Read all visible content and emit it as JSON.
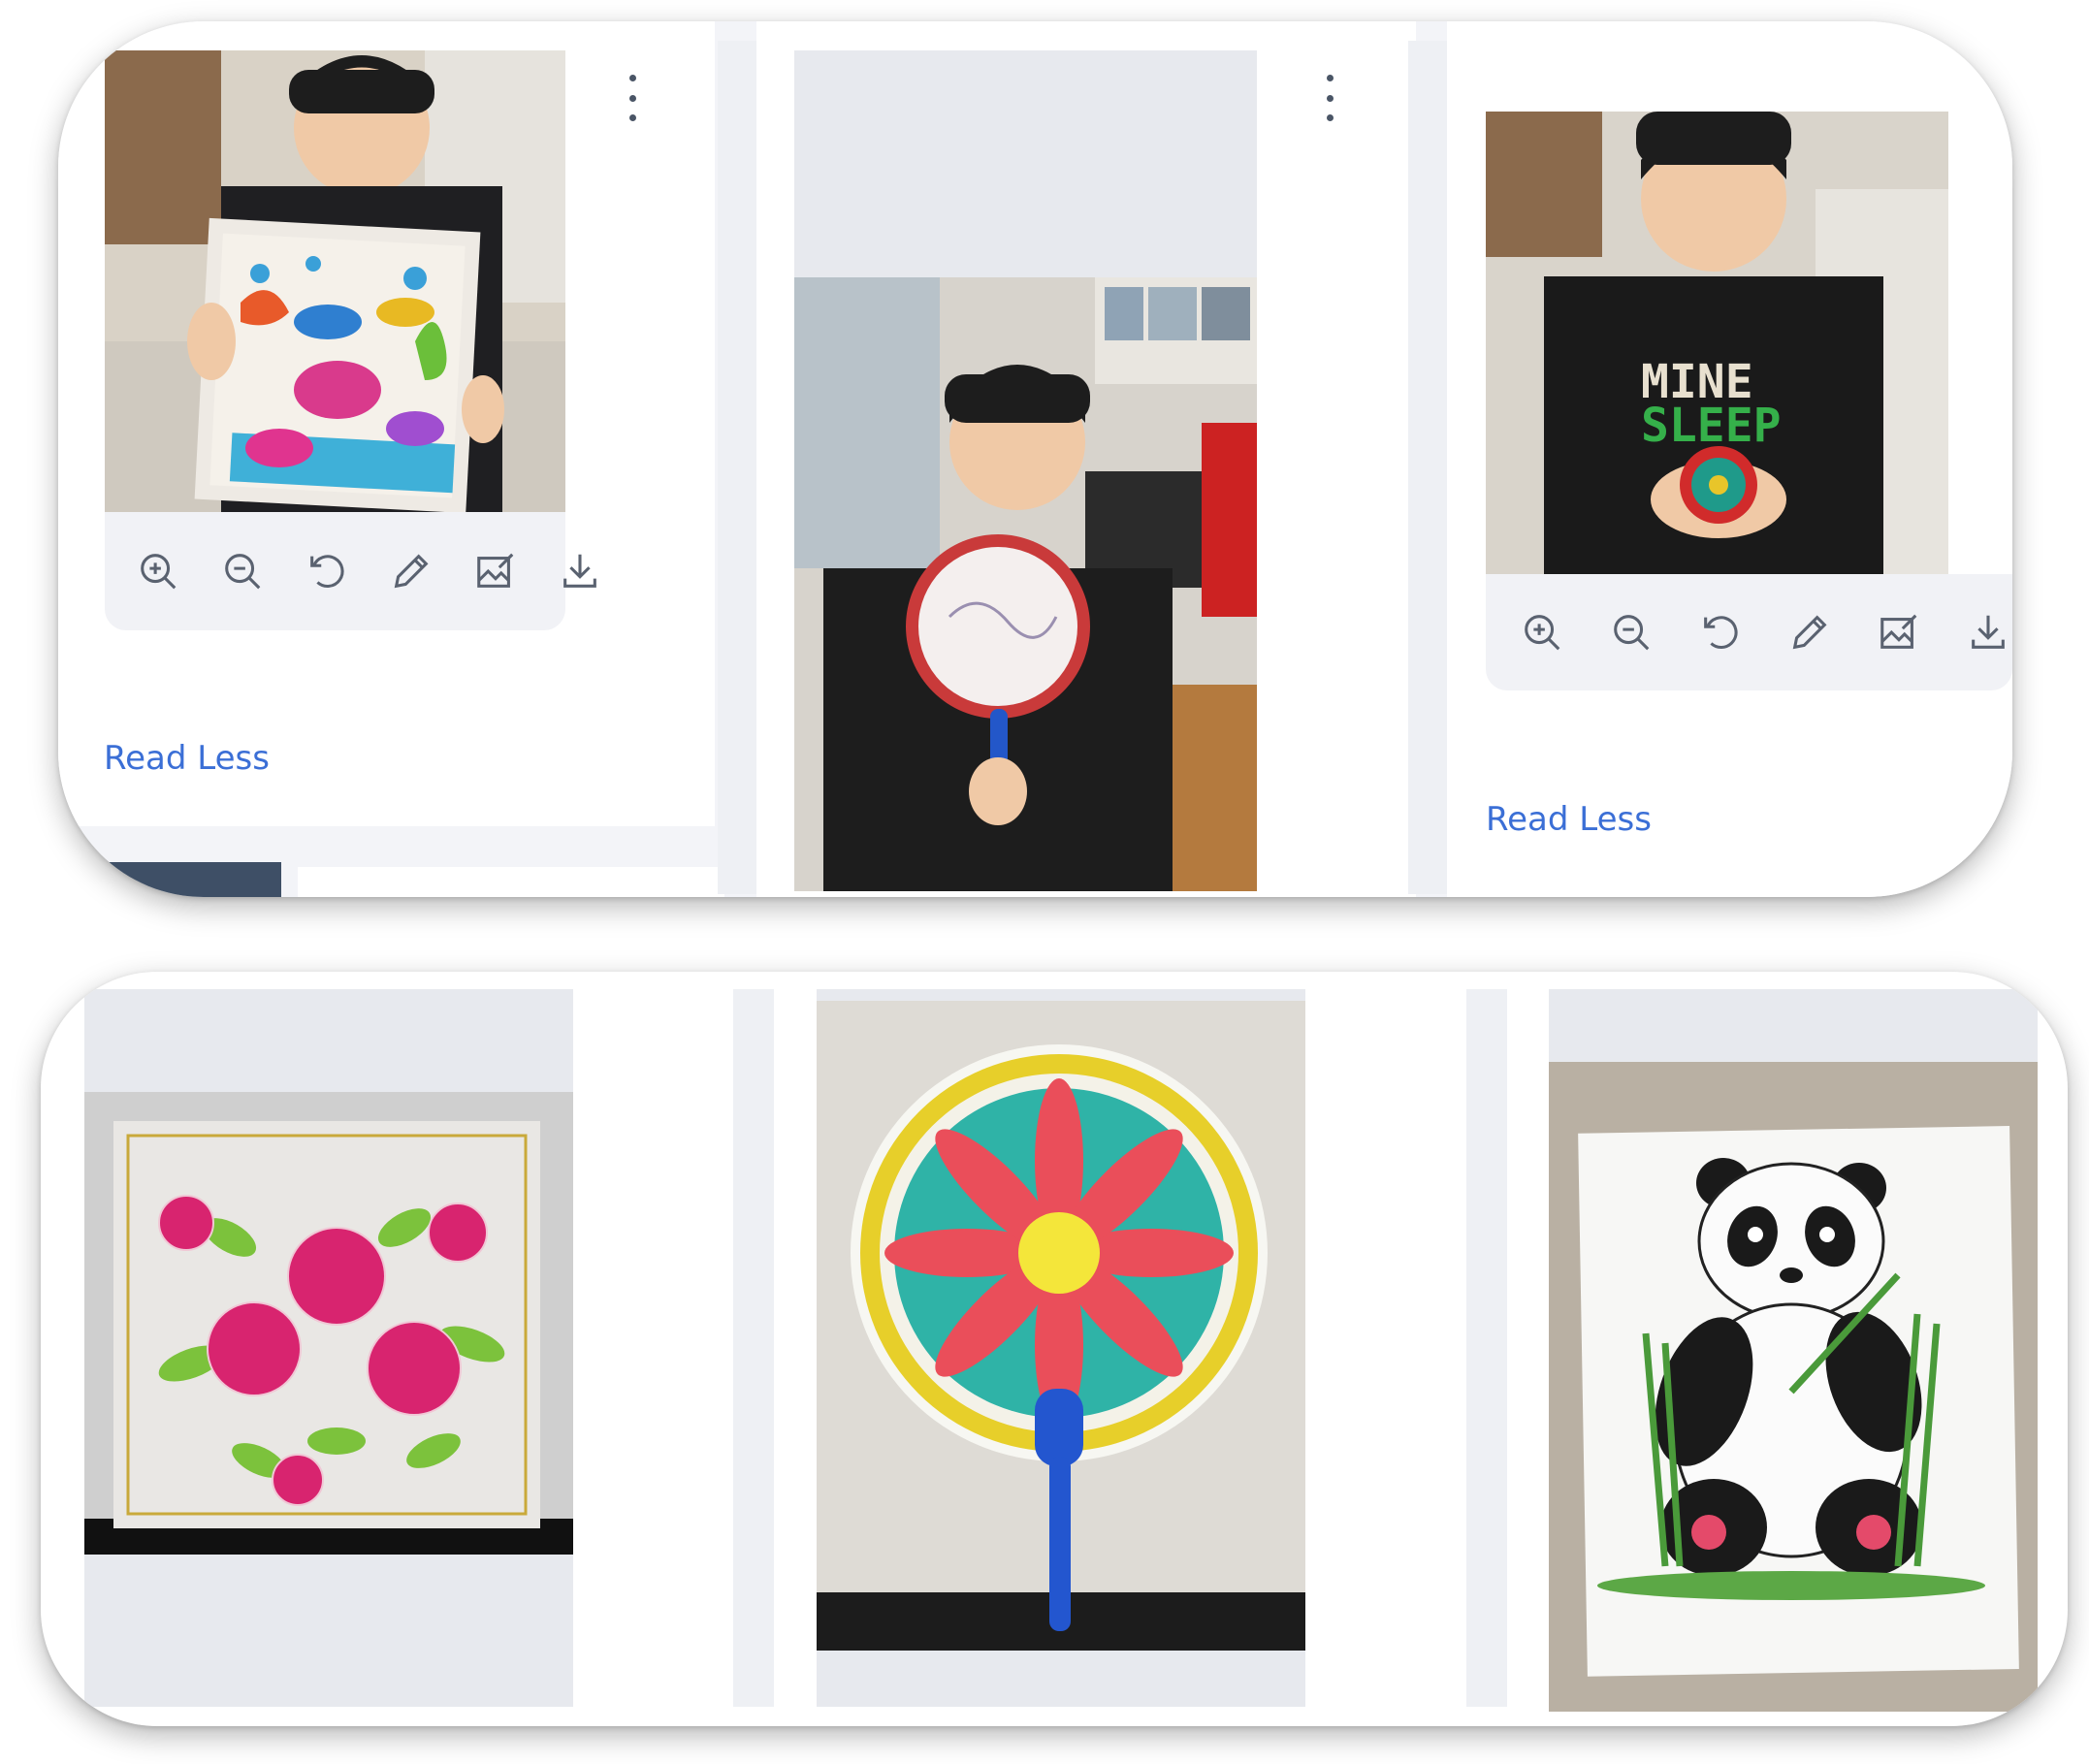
{
  "top_row": {
    "cards": [
      {
        "id": "card-1",
        "image_alt": "Boy holding coloured underwater sea life painting",
        "menu_icon": "kebab-menu-icon",
        "toolbar": [
          "zoom-in-icon",
          "zoom-out-icon",
          "rotate-left-icon",
          "pencil-edit-icon",
          "image-edit-icon",
          "download-icon"
        ],
        "link_label": "Read Less"
      },
      {
        "id": "card-2",
        "image_alt": "Boy holding paper hand fan with dragon drawing",
        "menu_icon": "kebab-menu-icon"
      },
      {
        "id": "card-3",
        "image_alt": "Boy in black t-shirt holding green clay flower",
        "toolbar": [
          "zoom-in-icon",
          "zoom-out-icon",
          "rotate-left-icon",
          "pencil-edit-icon",
          "image-edit-icon",
          "download-icon"
        ],
        "link_label": "Read Less"
      }
    ]
  },
  "bottom_row": {
    "images": [
      {
        "id": "art-roses",
        "alt": "Painted roses artwork on silk board"
      },
      {
        "id": "art-fan",
        "alt": "Coloured fan with red flower and turquoise background"
      },
      {
        "id": "art-panda",
        "alt": "Drawing of a panda holding bamboo"
      }
    ]
  },
  "colors": {
    "link_blue": "#3b6fd6",
    "panel_bg": "#f3f4f8",
    "card_bg": "#ffffff",
    "toolbar_bg": "#f1f2f6",
    "icon_gray": "#5a6270"
  }
}
